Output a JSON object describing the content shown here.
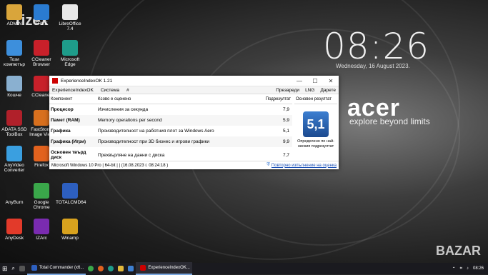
{
  "watermark": "rizex",
  "corner_watermark": "BAZAR",
  "clock": {
    "time": "08:26",
    "date": "Wednesday, 16 August 2023."
  },
  "brand": {
    "logo": "acer",
    "tagline": "explore beyond limits"
  },
  "desktop_icons": [
    {
      "label": "ADMIN",
      "color": "#d9a53b"
    },
    {
      "label": "FREE",
      "color": "#2a7bd1"
    },
    {
      "label": "LibreOffice 7.4",
      "color": "#e8e8e8"
    },
    {
      "label": "Този компютър",
      "color": "#3d8fdc"
    },
    {
      "label": "CCleaner Browser",
      "color": "#c8202a"
    },
    {
      "label": "Microsoft Edge",
      "color": "#1e9c8a"
    },
    {
      "label": "Кошче",
      "color": "#8ab0d0"
    },
    {
      "label": "CCleaner",
      "color": "#c8202a"
    },
    {
      "label": "ADATA SSD ToolBox",
      "color": "#b0202a"
    },
    {
      "label": "FastStone Image View",
      "color": "#d8701e"
    },
    {
      "label": "AnyVideo Converter",
      "color": "#3a9fe0"
    },
    {
      "label": "Firefox",
      "color": "#e2621e"
    },
    {
      "label": "AnyBurn",
      "color": "#1a1a1a"
    },
    {
      "label": "Google Chrome",
      "color": "#3aa74a"
    },
    {
      "label": "TOTALCMD64",
      "color": "#2d5fbf"
    },
    {
      "label": "AnyDesk",
      "color": "#e23a2a"
    },
    {
      "label": "IZArc",
      "color": "#7a2bb0"
    },
    {
      "label": "Winamp",
      "color": "#d8a21e"
    }
  ],
  "window": {
    "title": "ExperienceIndexOK 1.21",
    "controls": {
      "minimize": "—",
      "maximize": "☐",
      "close": "✕"
    },
    "menu_left": [
      "ExperienceIndexOK",
      "Система",
      "#"
    ],
    "menu_right": [
      "Презареди",
      "LNG",
      "Дарете"
    ],
    "columns": [
      "Компонент",
      "Ксово е оценено",
      "Подрезултат"
    ],
    "rows": [
      {
        "component": "Процесор",
        "rated": "Изчисления за секунда",
        "score": "7,9"
      },
      {
        "component": "Памет (RAM)",
        "rated": "Memory operations per second",
        "score": "5,9"
      },
      {
        "component": "Графика",
        "rated": "Производителност на работния плот за Windows Aero",
        "score": "5,1"
      },
      {
        "component": "Графика (Игри)",
        "rated": "Производителност при 3D бизнес и игрови графики",
        "score": "9,9"
      },
      {
        "component": "Основен твърд диск",
        "rated": "Прехвърляне на данни с диска",
        "score": "7,7"
      }
    ],
    "base_header": "Основен резултат",
    "base_score": "5,1",
    "base_caption": "Определено по най-ниския подрезултат",
    "status_left": "Microsoft Windows 10 Pro | 64-bit | | (16.08.2023 г. 08:24:18 )",
    "status_link": "Повторно изпълнение на оценка"
  },
  "taskbar": {
    "items": [
      "Total Commander (x6...",
      "ExperienceIndexOK..."
    ],
    "time": "08:26"
  }
}
